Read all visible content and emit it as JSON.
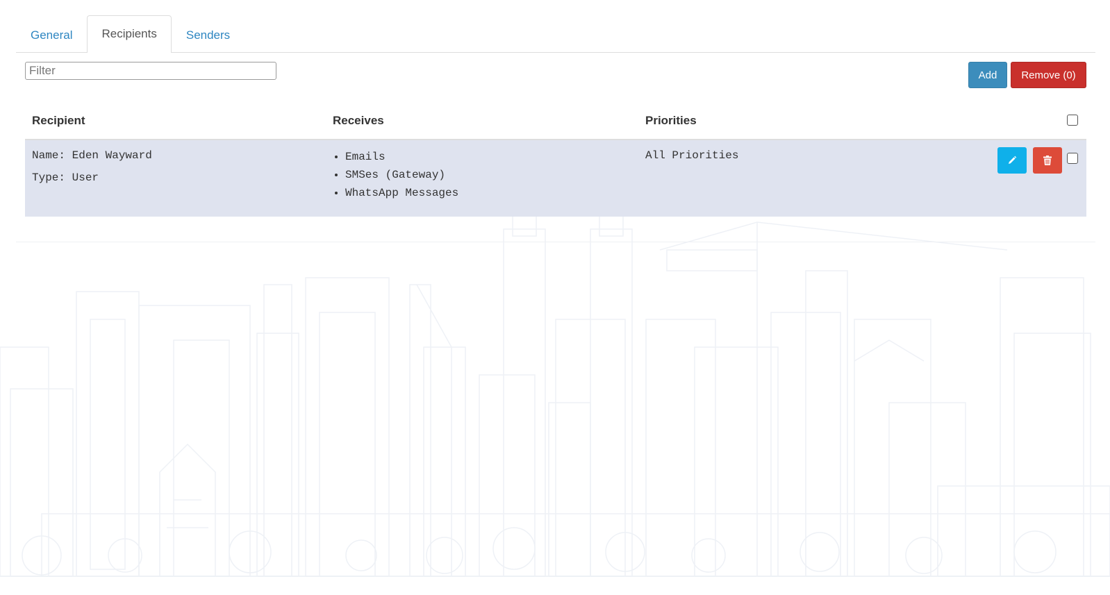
{
  "tabs": [
    {
      "label": "General",
      "active": false
    },
    {
      "label": "Recipients",
      "active": true
    },
    {
      "label": "Senders",
      "active": false
    }
  ],
  "filter": {
    "placeholder": "Filter",
    "value": ""
  },
  "actions": {
    "add_label": "Add",
    "remove_label": "Remove (0)"
  },
  "table": {
    "headers": {
      "recipient": "Recipient",
      "receives": "Receives",
      "priorities": "Priorities"
    },
    "rows": [
      {
        "name": "Name: Eden Wayward",
        "type": "Type: User",
        "receives": [
          "Emails",
          "SMSes (Gateway)",
          "WhatsApp Messages"
        ],
        "priorities": "All Priorities",
        "selected": false
      }
    ]
  },
  "icons": {
    "edit": "pencil-icon",
    "delete": "trash-icon"
  },
  "colors": {
    "link": "#2e86c1",
    "add_button": "#3c8dbc",
    "remove_button": "#c9302c",
    "edit_button": "#0fb0ea",
    "delete_button": "#dd4b39",
    "row_highlight": "#dfe3ef"
  }
}
